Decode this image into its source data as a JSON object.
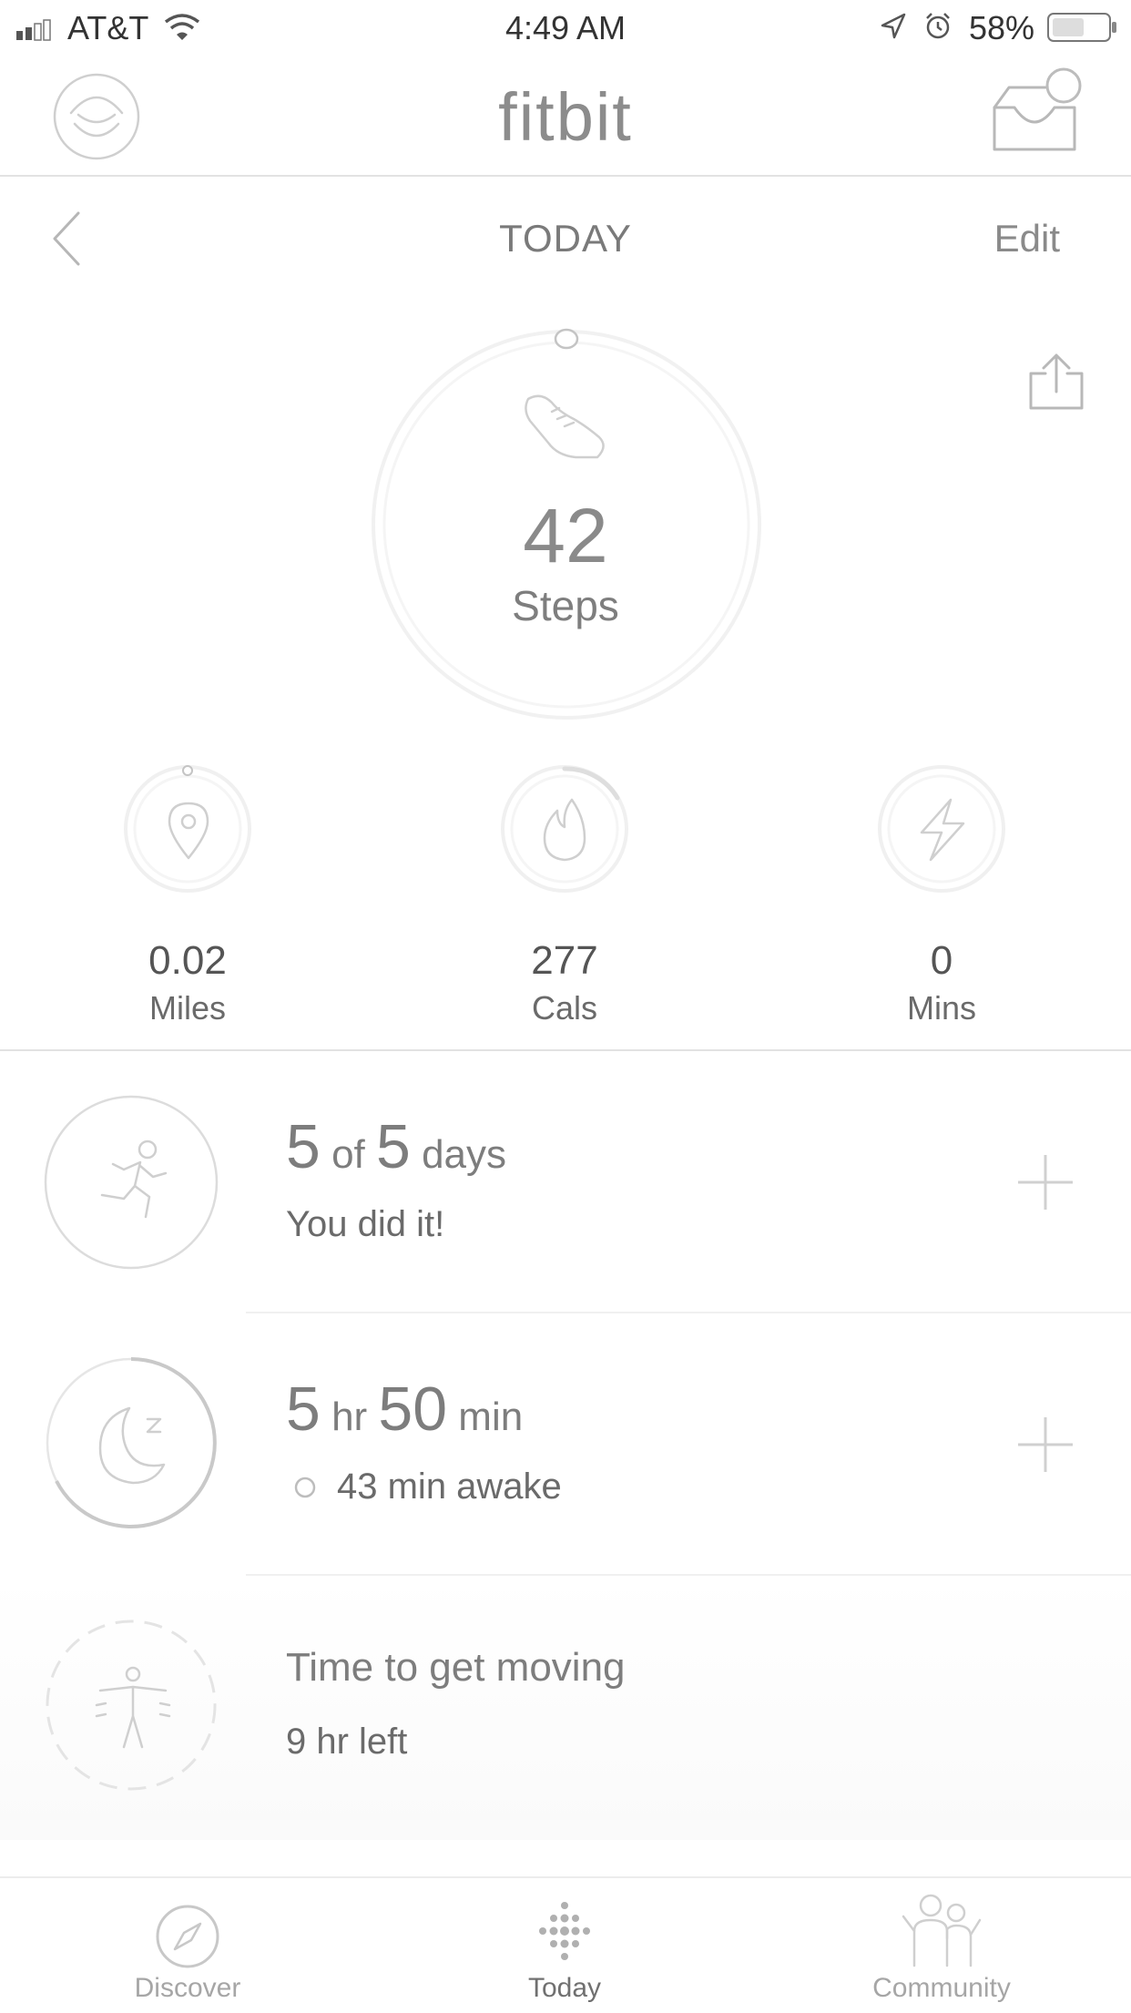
{
  "status_bar": {
    "carrier": "AT&T",
    "time": "4:49 AM",
    "battery": "58%"
  },
  "header": {
    "logo": "fitbit"
  },
  "day_nav": {
    "title": "TODAY",
    "edit_label": "Edit"
  },
  "steps": {
    "value": "42",
    "label": "Steps"
  },
  "stats": [
    {
      "value": "0.02",
      "label": "Miles",
      "icon": "location-pin-icon"
    },
    {
      "value": "277",
      "label": "Cals",
      "icon": "flame-icon"
    },
    {
      "value": "0",
      "label": "Mins",
      "icon": "lightning-icon"
    }
  ],
  "exercise": {
    "count": "5",
    "of": "of",
    "goal": "5",
    "unit": "days",
    "subtitle": "You did it!"
  },
  "sleep": {
    "hours": "5",
    "hours_unit": "hr",
    "minutes": "50",
    "minutes_unit": "min",
    "awake": "43 min awake"
  },
  "hourly": {
    "title": "Time to get moving",
    "subtitle": "9 hr left"
  },
  "tabs": [
    {
      "label": "Discover",
      "icon": "compass-icon",
      "active": false
    },
    {
      "label": "Today",
      "icon": "fitbit-dots-icon",
      "active": true
    },
    {
      "label": "Community",
      "icon": "community-icon",
      "active": false
    }
  ]
}
